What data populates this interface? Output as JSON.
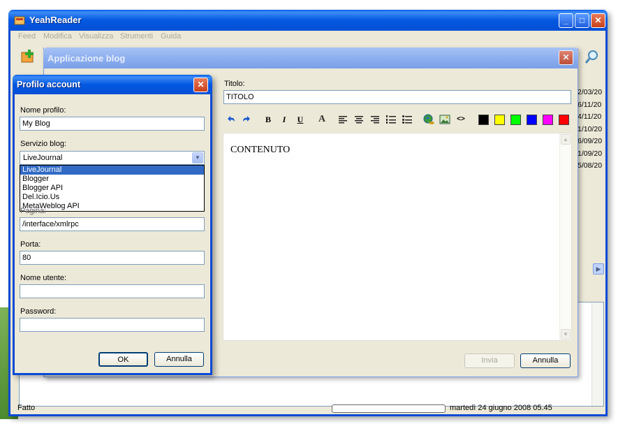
{
  "main_window": {
    "title": "YeahReader",
    "menu": [
      "Feed",
      "Modifica",
      "Visualizza",
      "Strumenti",
      "Guida"
    ],
    "dates": [
      "2/03/20",
      "6/11/20",
      "4/11/20",
      "1/10/20",
      "6/09/20",
      "1/09/20",
      "5/08/20"
    ],
    "status": "Fatto",
    "status_date": "martedì 24 giugno 2008 05.45"
  },
  "blog_window": {
    "title": "Applicazione blog",
    "title_label": "Titolo:",
    "title_value": "TITOLO",
    "content": "CONTENUTO",
    "colors": [
      "#000000",
      "#ffff00",
      "#00ff00",
      "#0000ff",
      "#ff00ff",
      "#ff0000"
    ],
    "html_tag_label": "<>",
    "font_label": "A",
    "bold_label": "B",
    "italic_label": "I",
    "underline_label": "U",
    "send_label": "Invia",
    "cancel_label": "Annulla"
  },
  "profile_dialog": {
    "title": "Profilo account",
    "profile_name_label": "Nome profilo:",
    "profile_name_value": "My Blog",
    "service_label": "Servizio blog:",
    "service_value": "LiveJournal",
    "service_options": [
      "LiveJournal",
      "Blogger",
      "Blogger API",
      "Del.Icio.Us",
      "MetaWeblog API"
    ],
    "page_label": "Pagina:",
    "page_value": "/interface/xmlrpc",
    "port_label": "Porta:",
    "port_value": "80",
    "username_label": "Nome utente:",
    "username_value": "",
    "password_label": "Password:",
    "password_value": "",
    "ok_label": "OK",
    "cancel_label": "Annulla"
  }
}
